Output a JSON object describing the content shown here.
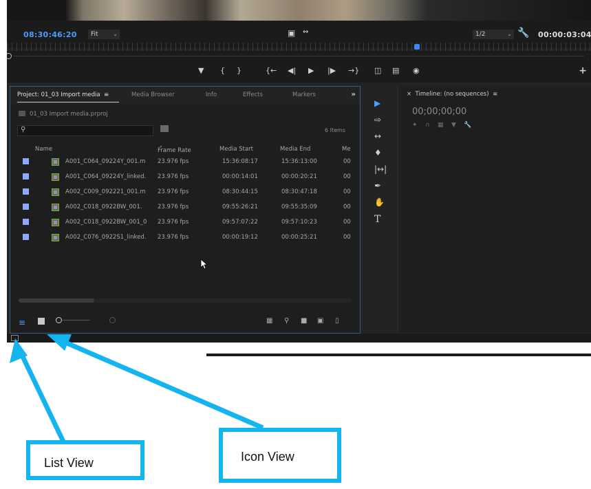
{
  "monitor": {
    "timecode_left": "08:30:46:20",
    "fit_label": "Fit",
    "resolution_label": "1/2",
    "timecode_right": "00:00:03:04"
  },
  "project_panel": {
    "tabs": [
      "Project: 01_03 Import media",
      "Media Browser",
      "Info",
      "Effects",
      "Markers"
    ],
    "project_file": "01_03 Import media.prproj",
    "items_count": "6 Items",
    "columns": [
      "Name",
      "Frame Rate",
      "Media Start",
      "Media End",
      "Me"
    ],
    "rows": [
      {
        "name": "A001_C064_09224Y_001.m",
        "frame_rate": "23.976 fps",
        "media_start": "15:36:08:17",
        "media_end": "15:36:13:00",
        "extra": "00"
      },
      {
        "name": "A001_C064_09224Y_linked.",
        "frame_rate": "23.976 fps",
        "media_start": "00:00:14:01",
        "media_end": "00:00:20:21",
        "extra": "00"
      },
      {
        "name": "A002_C009_092221_001.m",
        "frame_rate": "23.976 fps",
        "media_start": "08:30:44:15",
        "media_end": "08:30:47:18",
        "extra": "00"
      },
      {
        "name": "A002_C018_0922BW_001.",
        "frame_rate": "23.976 fps",
        "media_start": "09:55:26:21",
        "media_end": "09:55:35:09",
        "extra": "00"
      },
      {
        "name": "A002_C018_0922BW_001_0",
        "frame_rate": "23.976 fps",
        "media_start": "09:57:07:22",
        "media_end": "09:57:10:23",
        "extra": "00"
      },
      {
        "name": "A002_C076_0922S1_linked.",
        "frame_rate": "23.976 fps",
        "media_start": "00:00:19:12",
        "media_end": "00:00:25:21",
        "extra": "00"
      }
    ]
  },
  "timeline_panel": {
    "title": "Timeline: (no sequences)",
    "timecode": "00;00;00;00"
  },
  "callouts": {
    "list_view": "List View",
    "icon_view": "Icon View"
  },
  "colors": {
    "accent_blue": "#4a9eff",
    "callout_blue": "#14b4ee",
    "panel_bg": "#1e1e1e"
  }
}
